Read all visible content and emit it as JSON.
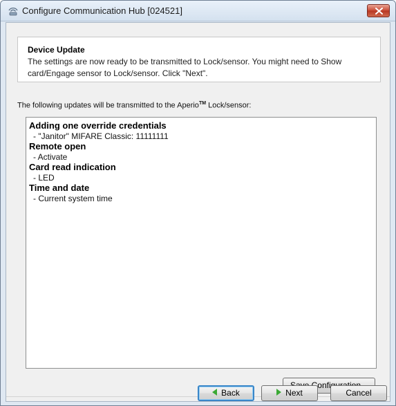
{
  "window": {
    "title": "Configure Communication Hub [024521]"
  },
  "header": {
    "title": "Device Update",
    "description": "The settings are now ready to be transmitted to Lock/sensor. You might need to Show card/Engage sensor to Lock/sensor. Click \"Next\"."
  },
  "info": {
    "prefix": "The following updates will be transmitted to the Aperio",
    "trademark": "TM",
    "suffix": " Lock/sensor:"
  },
  "updates": [
    {
      "heading": "Adding one override credentials",
      "detail": "- \"Janitor\" MIFARE Classic: 11111111"
    },
    {
      "heading": "Remote open",
      "detail": "- Activate"
    },
    {
      "heading": "Card read indication",
      "detail": "- LED"
    },
    {
      "heading": "Time and date",
      "detail": "- Current system time"
    }
  ],
  "buttons": {
    "save": "Save Configuration...",
    "back": "Back",
    "next": "Next",
    "cancel": "Cancel"
  },
  "icons": {
    "window": "wireless-hub-icon",
    "close": "close-icon",
    "back": "arrow-left-icon",
    "next": "arrow-right-icon"
  },
  "colors": {
    "close_button": "#c84a34",
    "arrow_green": "#3aa935",
    "focus_border": "#3a86c8"
  }
}
